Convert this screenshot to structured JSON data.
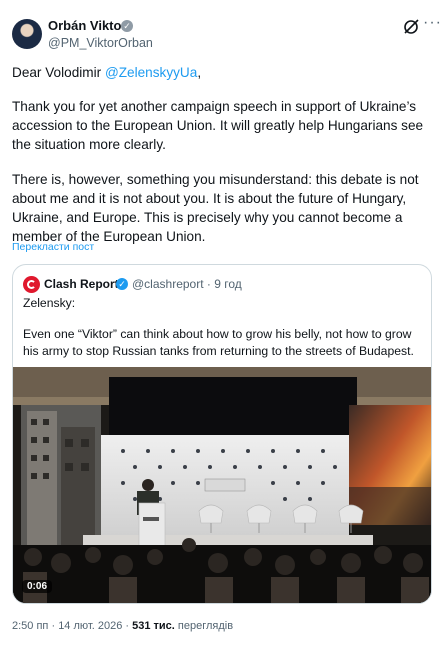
{
  "author": {
    "name": "Orbán Viktor",
    "handle": "@PM_ViktorOrban",
    "avatar_icon": "portrait-avatar"
  },
  "post": {
    "greeting_prefix": "Dear Volodimir ",
    "greeting_mention": "@ZelenskyyUa",
    "greeting_suffix": ",",
    "paragraph_1": "Thank you for yet another campaign speech in support of Ukraine’s accession to the European Union. It will greatly help Hungarians see the situation more clearly.",
    "paragraph_2": "There is, however, something you misunderstand: this debate is not about me and it is not about you. It is about the future of Hungary, Ukraine, and Europe. This is precisely why you cannot become a member of the European Union.",
    "translate_label": "Перекласти пост"
  },
  "quote": {
    "name": "Clash Report",
    "handle": "@clashreport",
    "separator": "·",
    "age": "9 год",
    "line_1": "Zelensky:",
    "line_2": "Even one “Viktor” can think about how to grow his belly, not how to grow his army to stop Russian tanks from returning to the streets of Budapest.",
    "video_duration": "0:06"
  },
  "meta": {
    "time": "2:50 пп",
    "dot": "·",
    "date": "14 лют. 2026",
    "views_count": "531 тис.",
    "views_label": "переглядів"
  },
  "colors": {
    "accent": "#1d9bf0",
    "clash_red": "#e0182d",
    "verified_gray": "#8f9ba6"
  }
}
